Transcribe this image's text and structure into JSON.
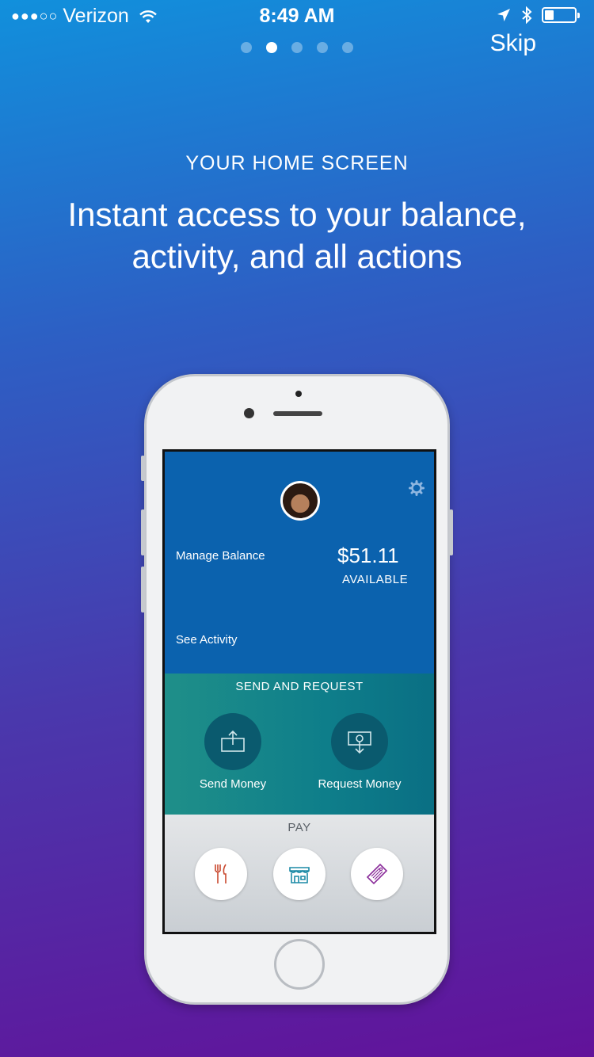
{
  "status_bar": {
    "signal": "●●●○○",
    "carrier": "Verizon",
    "time": "8:49 AM",
    "battery_level": 0.3
  },
  "pager": {
    "count": 5,
    "active_index": 1
  },
  "skip_label": "Skip",
  "eyebrow": "YOUR HOME SCREEN",
  "headline": "Instant access to your balance, activity, and all actions",
  "phone_screen": {
    "manage_balance": "Manage Balance",
    "balance_amount": "$51.11",
    "balance_caption": "AVAILABLE",
    "see_activity": "See Activity",
    "send_request_title": "SEND AND REQUEST",
    "send_money": "Send Money",
    "request_money": "Request Money",
    "pay_title": "PAY",
    "pay_icons": [
      "fork-knife-icon",
      "storefront-icon",
      "ticket-icon"
    ]
  },
  "colors": {
    "top_section": "#0b62ae",
    "teal_section": "#0e7e8a",
    "dining_icon": "#c9492f",
    "store_icon": "#1b8aa6",
    "ticket_icon": "#8a2c9a"
  }
}
